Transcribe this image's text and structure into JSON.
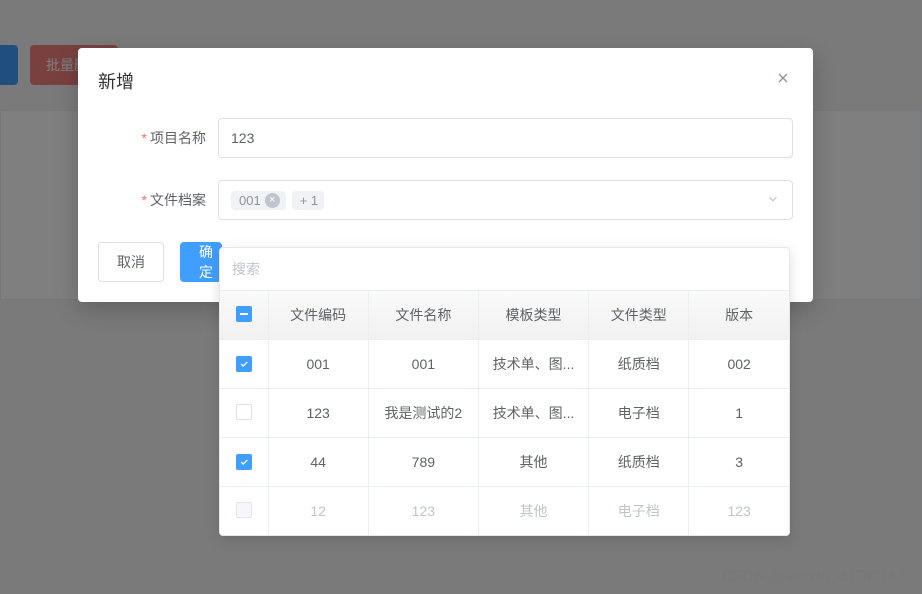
{
  "background": {
    "delete_btn": "批量删除"
  },
  "dialog": {
    "title": "新增",
    "close_aria": "close",
    "labels": {
      "project_name": "项目名称",
      "file_archive": "文件档案"
    },
    "project_name_value": "123",
    "file_tag": "001",
    "file_more": "+ 1",
    "cancel": "取消",
    "confirm": "确定"
  },
  "dropdown": {
    "search_placeholder": "搜索",
    "columns": [
      "文件编码",
      "文件名称",
      "模板类型",
      "文件类型",
      "版本"
    ],
    "rows": [
      {
        "checked": true,
        "disabled": false,
        "code": "001",
        "name": "001",
        "template": "技术单、图...",
        "ftype": "纸质档",
        "version": "002"
      },
      {
        "checked": false,
        "disabled": false,
        "code": "123",
        "name": "我是测试的2",
        "template": "技术单、图...",
        "ftype": "电子档",
        "version": "1"
      },
      {
        "checked": true,
        "disabled": false,
        "code": "44",
        "name": "789",
        "template": "其他",
        "ftype": "纸质档",
        "version": "3"
      },
      {
        "checked": false,
        "disabled": true,
        "code": "12",
        "name": "123",
        "template": "其他",
        "ftype": "电子档",
        "version": "123"
      }
    ]
  },
  "watermark": "CSDN @weixin_43787161"
}
